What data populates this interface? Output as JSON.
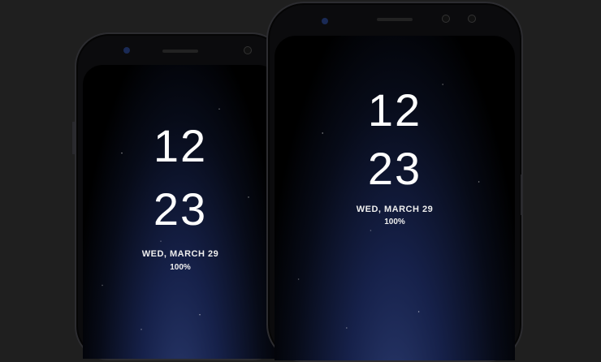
{
  "phones": [
    {
      "time_hour": "12",
      "time_minute": "23",
      "date": "WED, MARCH 29",
      "battery": "100%"
    },
    {
      "time_hour": "12",
      "time_minute": "23",
      "date": "WED, MARCH 29",
      "battery": "100%"
    }
  ]
}
